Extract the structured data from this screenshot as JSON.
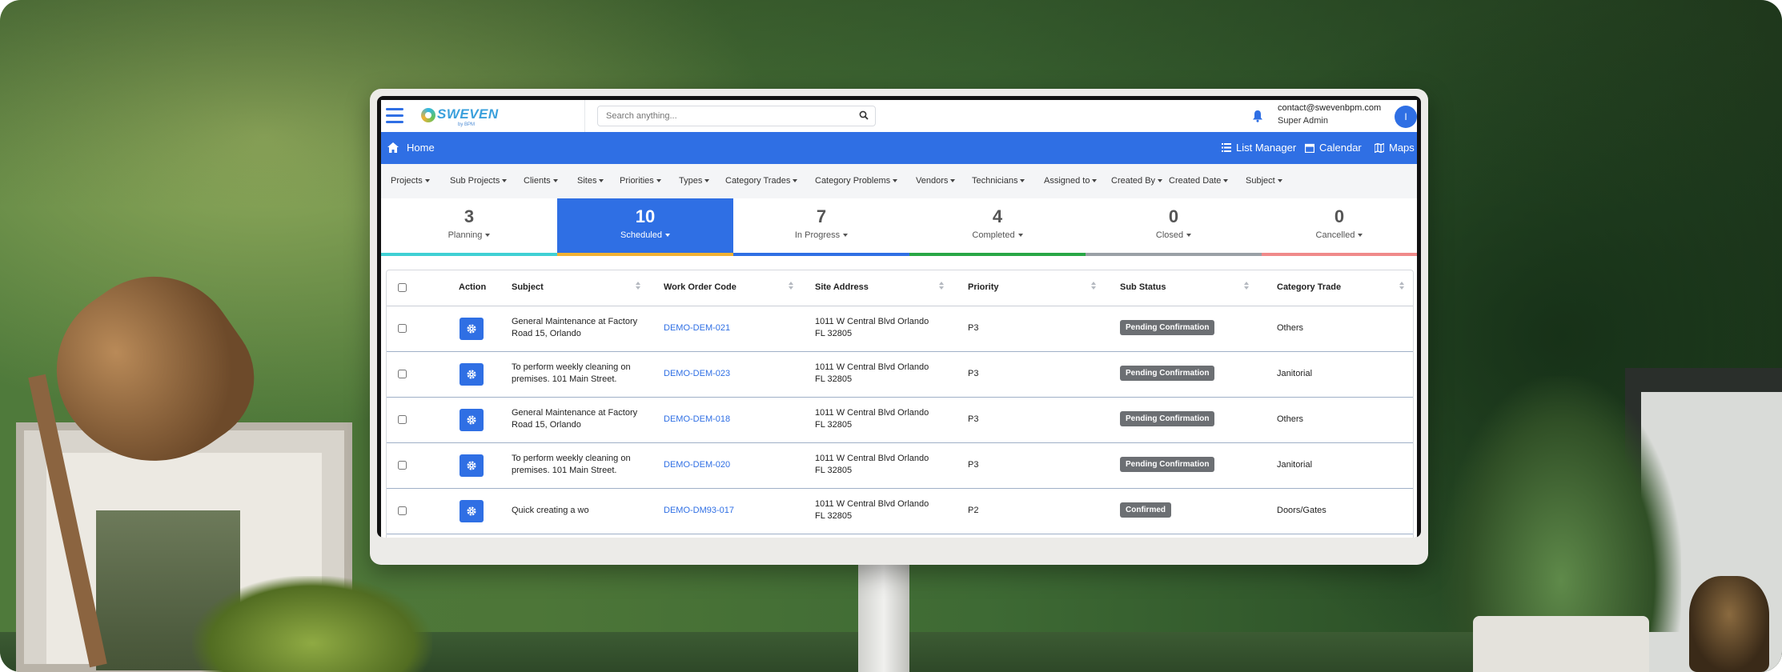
{
  "header": {
    "logo_text": "SWEVEN",
    "logo_subtext": "by BPM",
    "search_placeholder": "Search anything...",
    "user_email": "contact@swevenbpm.com",
    "user_role": "Super Admin",
    "avatar_initial": "I"
  },
  "nav": {
    "home": "Home",
    "list_manager": "List Manager",
    "calendar": "Calendar",
    "maps": "Maps"
  },
  "filters": [
    "Projects",
    "Sub Projects",
    "Clients",
    "Sites",
    "Priorities",
    "Types",
    "Category Trades",
    "Category Problems",
    "Vendors",
    "Technicians",
    "Assigned to",
    "Created By",
    "Created Date",
    "Subject"
  ],
  "stats": [
    {
      "count": "3",
      "label": "Planning",
      "color": "#3fd0d4"
    },
    {
      "count": "10",
      "label": "Scheduled",
      "color": "#f2b233"
    },
    {
      "count": "7",
      "label": "In Progress",
      "color": "#2f6fe4"
    },
    {
      "count": "4",
      "label": "Completed",
      "color": "#28a745"
    },
    {
      "count": "0",
      "label": "Closed",
      "color": "#9aa0a6"
    },
    {
      "count": "0",
      "label": "Cancelled",
      "color": "#f08a8a"
    }
  ],
  "table": {
    "columns": [
      "Action",
      "Subject",
      "Work Order Code",
      "Site Address",
      "Priority",
      "Sub Status",
      "Category Trade"
    ],
    "rows": [
      {
        "subject_1": "General Maintenance at Factory",
        "subject_2": "Road 15, Orlando",
        "code": "DEMO-DEM-021",
        "address_1": "1011 W Central Blvd Orlando",
        "address_2": "FL 32805",
        "priority": "P3",
        "status": "Pending Confirmation",
        "trade": "Others"
      },
      {
        "subject_1": "To perform weekly cleaning on",
        "subject_2": "premises. 101 Main Street.",
        "code": "DEMO-DEM-023",
        "address_1": "1011 W Central Blvd Orlando",
        "address_2": "FL 32805",
        "priority": "P3",
        "status": "Pending Confirmation",
        "trade": "Janitorial"
      },
      {
        "subject_1": "General Maintenance at Factory",
        "subject_2": "Road 15, Orlando",
        "code": "DEMO-DEM-018",
        "address_1": "1011 W Central Blvd Orlando",
        "address_2": "FL 32805",
        "priority": "P3",
        "status": "Pending Confirmation",
        "trade": "Others"
      },
      {
        "subject_1": "To perform weekly cleaning on",
        "subject_2": "premises. 101 Main Street.",
        "code": "DEMO-DEM-020",
        "address_1": "1011 W Central Blvd Orlando",
        "address_2": "FL 32805",
        "priority": "P3",
        "status": "Pending Confirmation",
        "trade": "Janitorial"
      },
      {
        "subject_1": "Quick creating a wo",
        "subject_2": "",
        "code": "DEMO-DM93-017",
        "address_1": "1011 W Central Blvd Orlando",
        "address_2": "FL 32805",
        "priority": "P2",
        "status": "Confirmed",
        "trade": "Doors/Gates"
      }
    ]
  },
  "colors": {
    "accent": "#2f6fe4",
    "badge": "#6c6f73"
  }
}
